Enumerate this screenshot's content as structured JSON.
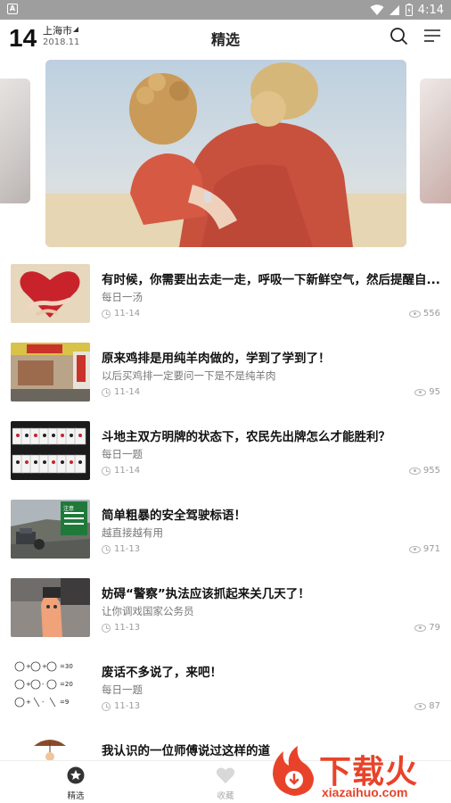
{
  "status_bar": {
    "time": "4:14"
  },
  "header": {
    "day": "14",
    "city": "上海市",
    "date": "2018.11",
    "title": "精选",
    "icons": {
      "search": "search-icon",
      "menu": "menu-icon"
    }
  },
  "carousel": {
    "slides": [
      "mother-and-child",
      "adjacent-slide-left",
      "adjacent-slide-right"
    ]
  },
  "articles": [
    {
      "title": "有时候，你需要出去走一走，呼吸一下新鲜空气，然后提醒自...",
      "subtitle": "每日一汤",
      "date": "11-14",
      "views": "556",
      "thumb": "heart-hug"
    },
    {
      "title": "原来鸡排是用纯羊肉做的，学到了学到了！",
      "subtitle": "以后买鸡排一定要问一下是不是纯羊肉",
      "date": "11-14",
      "views": "95",
      "thumb": "shop-front"
    },
    {
      "title": "斗地主双方明牌的状态下，农民先出牌怎么才能胜利？",
      "subtitle": "每日一题",
      "date": "11-14",
      "views": "955",
      "thumb": "playing-cards"
    },
    {
      "title": "简单粗暴的安全驾驶标语！",
      "subtitle": "越直接越有用",
      "date": "11-13",
      "views": "971",
      "thumb": "road-sign"
    },
    {
      "title": "妨碍“警察”执法应该抓起来关几天了！",
      "subtitle": "让你调戏国家公务员",
      "date": "11-13",
      "views": "79",
      "thumb": "hand-toy"
    },
    {
      "title": "废话不多说了，来吧！",
      "subtitle": "每日一题",
      "date": "11-13",
      "views": "87",
      "thumb": "cat-math-puzzle"
    },
    {
      "title": "我认识的一位师傅说过这样的道",
      "subtitle": "",
      "date": "",
      "views": "",
      "thumb": "umbrella-figure"
    }
  ],
  "puzzle_numbers": [
    "=30",
    "=20",
    "=9"
  ],
  "thumb_sign_text": "注意",
  "bottom_nav": {
    "tabs": [
      {
        "label": "精选",
        "icon": "star-icon",
        "active": true
      },
      {
        "label": "收藏",
        "icon": "heart-icon",
        "active": false
      }
    ]
  },
  "watermark": {
    "brand": "下载火",
    "url": "xiazaihuo.com"
  },
  "colors": {
    "accent": "#e8432a",
    "status_bar": "#9e9e9e",
    "text_primary": "#111111",
    "text_secondary": "#777777"
  }
}
